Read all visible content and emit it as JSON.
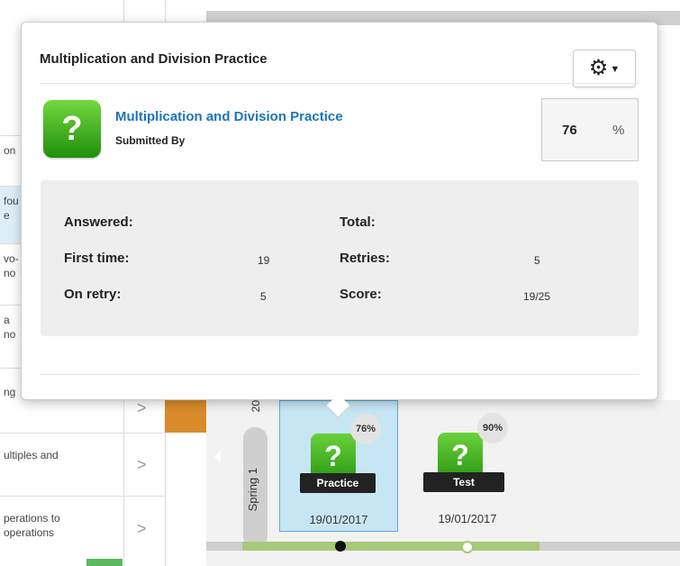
{
  "popover": {
    "title": "Multiplication and Division Practice",
    "activity_name": "Multiplication and Division Practice",
    "submitted_by_label": "Submitted By",
    "score_value": "76",
    "score_unit": "%",
    "stats": {
      "answered_label": "Answered:",
      "total_label": "Total:",
      "first_time_label": "First time:",
      "first_time_value": "19",
      "retries_label": "Retries:",
      "retries_value": "5",
      "on_retry_label": "On retry:",
      "on_retry_value": "5",
      "score_label": "Score:",
      "score_value": "19/25"
    }
  },
  "background": {
    "rows": [
      {
        "text": "on"
      },
      {
        "text": "fou\ne"
      },
      {
        "text": "vo-\nno"
      },
      {
        "text": "a\nno"
      },
      {
        "text": "ng"
      },
      {
        "text": "ultiples and"
      },
      {
        "text": "perations to\n operations"
      }
    ],
    "term_label": "Spring 1",
    "term_year": "20",
    "cards": [
      {
        "percent": "76%",
        "tag": "Practice",
        "date": "19/01/2017"
      },
      {
        "percent": "90%",
        "tag": "Test",
        "date": "19/01/2017"
      }
    ]
  },
  "colors": {
    "link": "#1b75bb",
    "icon_green": "#2e9b16",
    "active_card": "#c7e6f3",
    "track_fill": "#a7c97a",
    "orange_cell": "#d98a2b"
  },
  "icons": {
    "gear": "gear-icon",
    "activity": "question-mark-icon"
  }
}
